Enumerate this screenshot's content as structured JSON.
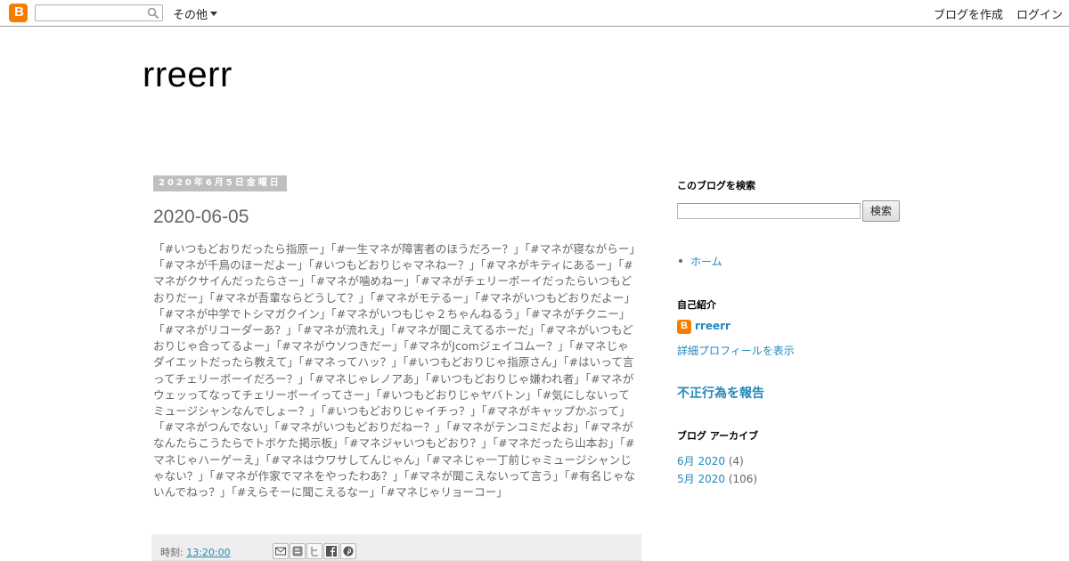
{
  "navbar": {
    "more_label": "その他",
    "create_blog": "ブログを作成",
    "login": "ログイン"
  },
  "blog": {
    "title": "rreerr"
  },
  "post": {
    "date_header": "2020年6月5日金曜日",
    "title": "2020-06-05",
    "body": "「#いつもどおりだったら指原ー」「#一生マネが障害者のほうだろー？」「#マネが寝ながらー」「#マネが千鳥のほーだよー」「#いつもどおりじゃマネねー？」「#マネがキティにあるー」「#マネがクサイんだったらさー」「#マネが噛めねー」「#マネがチェリーボーイだったらいつもどおりだー」「#マネが吾輩ならどうして？」「#マネがモテるー」「#マネがいつもどおりだよー」「#マネが中学でトシマガクイン」「#マネがいつもじゃ２ちゃんねるう」「#マネがチクニー」「#マネがリコーダーあ？」「#マネが流れえ」「#マネが聞こえてるホーだ」「#マネがいつもどおりじゃ合ってるよー」「#マネがウソつきだー」「#マネがJcomジェイコムー？」「#マネじゃダイエットだったら教えて」「#マネってハッ？」「#いつもどおりじゃ指原さん」「#はいって言ってチェリーボーイだろー？」「#マネじゃレノアあ」「#いつもどおりじゃ嫌われ者」「#マネがウェッってなってチェリーボーイってさー」「#いつもどおりじゃヤバトン」「#気にしないってミュージシャンなんでしょー？」「#いつもどおりじゃイチっ？」「#マネがキャップかぶって」「#マネがつんでない」「#マネがいつもどおりだねー？」「#マネがテンコミだよお」「#マネがなんたらこうたらでトボケた掲示板」「#マネジャいつもどおり？」「#マネだったら山本お」「#マネじゃハーゲーえ」「#マネはウワサしてんじゃん」「#マネじゃ一丁前じゃミュージシャンじゃない？」「#マネが作家でマネをやったわあ？」「#マネが聞こえないって言う」「#有名じゃないんでねっ？」「#えらそーに聞こえるなー」「#マネじゃリョーコー」",
    "time_label": "時刻: ",
    "time_value": "13:20:00"
  },
  "sidebar": {
    "search_title": "このブログを検索",
    "search_button": "検索",
    "home_link": "ホーム",
    "profile_title": "自己紹介",
    "profile_name": "rreerr",
    "profile_link": "詳細プロフィールを表示",
    "report_link": "不正行為を報告",
    "archive_title": "ブログ アーカイブ",
    "archive": [
      {
        "label": "6月 2020",
        "count": " (4)"
      },
      {
        "label": "5月 2020",
        "count": " (106)"
      }
    ]
  },
  "colors": {
    "accent_link": "#2288bb",
    "blogger_orange": "#f57d00",
    "date_header_bg": "#bfbfbf"
  }
}
